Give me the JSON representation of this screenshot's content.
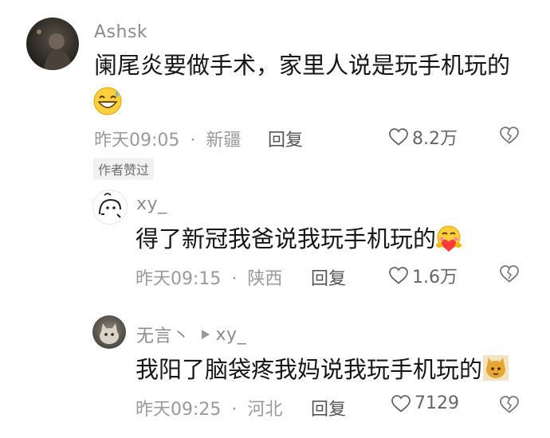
{
  "comments": [
    {
      "username": "Ashsk",
      "text": "阑尾炎要做手术，家里人说是玩手机玩的",
      "time": "昨天09:05",
      "location": "新疆",
      "reply_label": "回复",
      "likes": "8.2万",
      "badge": "作者赞过"
    },
    {
      "username": "xy_",
      "text": "得了新冠我爸说我玩手机玩的",
      "time": "昨天09:15",
      "location": "陕西",
      "reply_label": "回复",
      "likes": "1.6万"
    },
    {
      "username": "无言丶",
      "reply_to": "xy_",
      "text": "我阳了脑袋疼我妈说我玩手机玩的",
      "time": "昨天09:25",
      "location": "河北",
      "reply_label": "回复",
      "likes": "7129"
    }
  ],
  "separator": "·"
}
